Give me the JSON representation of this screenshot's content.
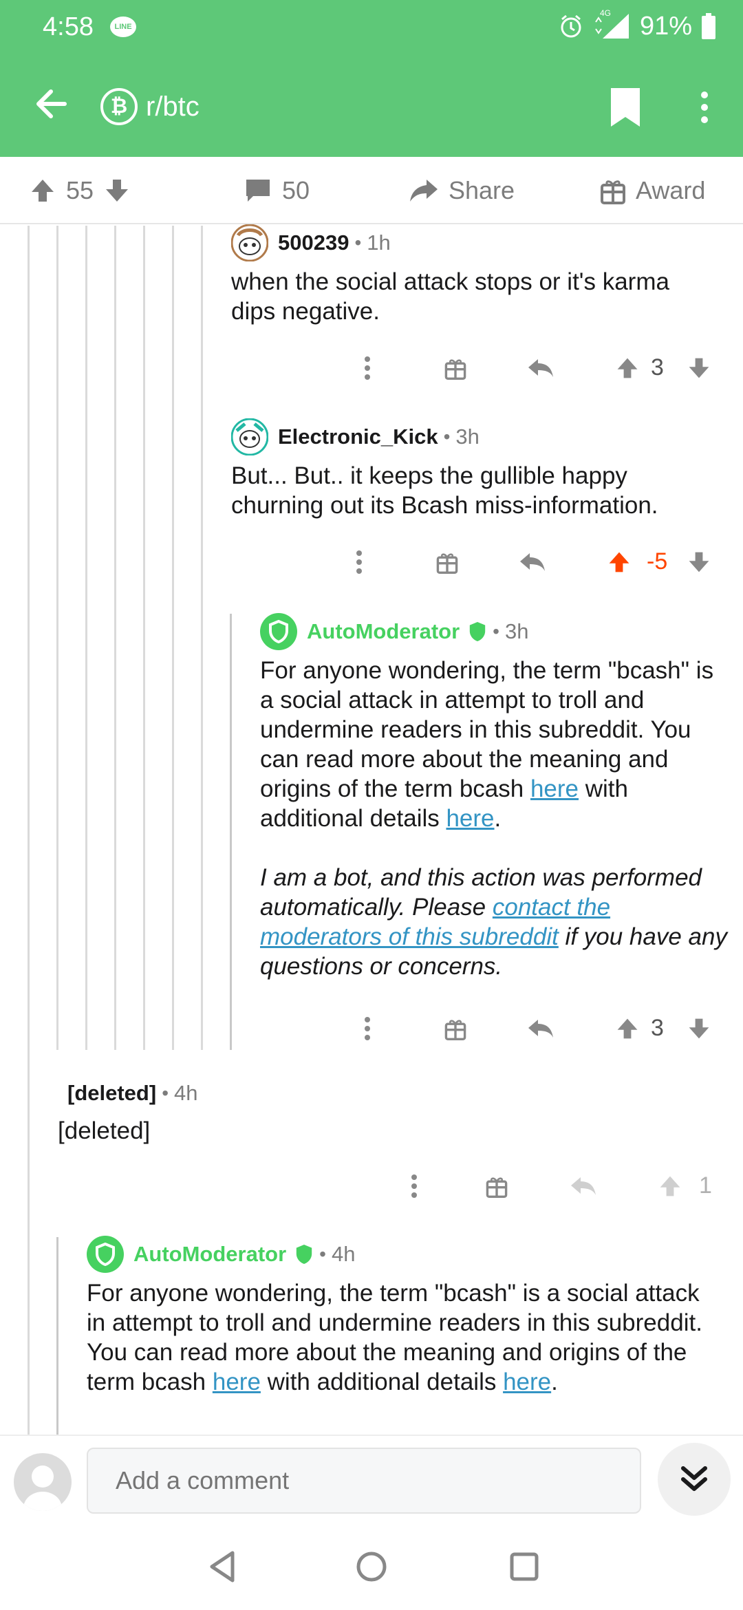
{
  "status_bar": {
    "time": "4:58",
    "line_badge": "LINE",
    "network": "4G",
    "battery": "91%"
  },
  "app_bar": {
    "subreddit": "r/btc",
    "sub_icon": "bitcoin-icon"
  },
  "post_actions": {
    "score": "55",
    "comments": "50",
    "share": "Share",
    "award": "Award"
  },
  "comments": [
    {
      "user": "500239",
      "time": "1h",
      "body": "when the social attack stops or it's karma dips negative.",
      "score": "3"
    },
    {
      "user": "Electronic_Kick",
      "time": "3h",
      "body": "But... But.. it keeps the gullible happy churning out its Bcash miss-information.",
      "score": "-5"
    },
    {
      "user": "AutoModerator",
      "time": "3h",
      "p1_a": "For anyone wondering, the term \"bcash\" is a social attack in attempt to troll and undermine readers in this subreddit. You can read more about the meaning and origins of the term bcash ",
      "link1": "here",
      "p1_b": " with additional details ",
      "link2": "here",
      "p1_c": ".",
      "p2_a": "I am a bot, and this action was performed automatically. Please ",
      "link3": "contact the moderators of this subreddit",
      "p2_b": " if you have any questions or concerns.",
      "score": "3"
    },
    {
      "user": "[deleted]",
      "time": "4h",
      "body": "[deleted]",
      "score": "1"
    },
    {
      "user": "AutoModerator",
      "time": "4h",
      "p1_a": "For anyone wondering, the term \"bcash\" is a social attack in attempt to troll and undermine readers in this subreddit. You can read more about the meaning and origins of the term bcash ",
      "link1": "here",
      "p1_b": " with additional details ",
      "link2": "here",
      "p1_c": "."
    }
  ],
  "comment_bar": {
    "placeholder": "Add a comment"
  },
  "colors": {
    "header": "#5ec878",
    "mod": "#46d160",
    "link": "#3394c4",
    "upvoted": "#ff4500"
  }
}
